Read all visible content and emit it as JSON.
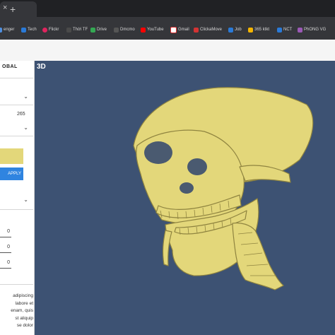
{
  "browser": {
    "new_tab_symbol": "+",
    "close_symbol": "×",
    "bookmarks": [
      {
        "label": "enger",
        "color": "#4f8fe0"
      },
      {
        "label": "Tech",
        "color": "#2a7ad8"
      },
      {
        "label": "Flickr",
        "color": "#e0245e"
      },
      {
        "label": "Thời TF",
        "color": "#4a4a4a"
      },
      {
        "label": "Drive",
        "color": "#34a853"
      },
      {
        "label": "Dmcmo",
        "color": "#555555"
      },
      {
        "label": "YouTube",
        "color": "#ff0000"
      },
      {
        "label": "Gmail",
        "color": "#ffffff"
      },
      {
        "label": "ClickaMove",
        "color": "#d33333"
      },
      {
        "label": "Job",
        "color": "#2a7ad8"
      },
      {
        "label": "365 ktkt",
        "color": "#f4b400"
      },
      {
        "label": "NCT",
        "color": "#2a7ad8"
      },
      {
        "label": "PhONG VG",
        "color": "#9b59b6"
      }
    ]
  },
  "sidebar": {
    "title": "OBAL",
    "number_value": "265",
    "apply_label": "APPLY",
    "fields": [
      "0",
      "0",
      "0"
    ],
    "lorem_lines": [
      "adipiscing",
      "labore et",
      "enam, quis",
      "st aliquip",
      "se dolor"
    ],
    "accent_color": "#2f84e0",
    "swatch_color": "#e3d77a"
  },
  "viewer": {
    "label": "3D",
    "background": "#3d5273",
    "model_color": "#e3d77a"
  }
}
